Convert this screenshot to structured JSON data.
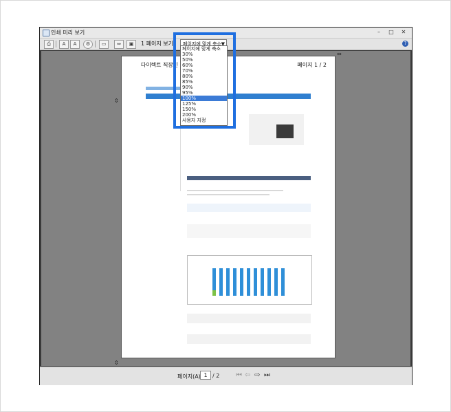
{
  "window": {
    "title": "인쇄 미리 보기"
  },
  "toolbar": {
    "page_view_label": "1 페이지 보기",
    "zoom_value": "페이지에 맞게 축소",
    "zoom_options": [
      "페이지에 맞게 축소",
      "30%",
      "50%",
      "60%",
      "70%",
      "80%",
      "85%",
      "90%",
      "95%",
      "100%",
      "125%",
      "150%",
      "200%",
      "사용자 지정"
    ],
    "selected_zoom": "100%",
    "help": "?"
  },
  "document": {
    "title": "다이렉트 직장인 대출",
    "page_indicator": "페이지 1 / 2"
  },
  "status": {
    "page_label": "페이지(A)",
    "current_page": "1",
    "total_pages": "/ 2"
  },
  "colors": {
    "highlight": "#1f6fe0",
    "selected_option": "#3b7bd6"
  }
}
